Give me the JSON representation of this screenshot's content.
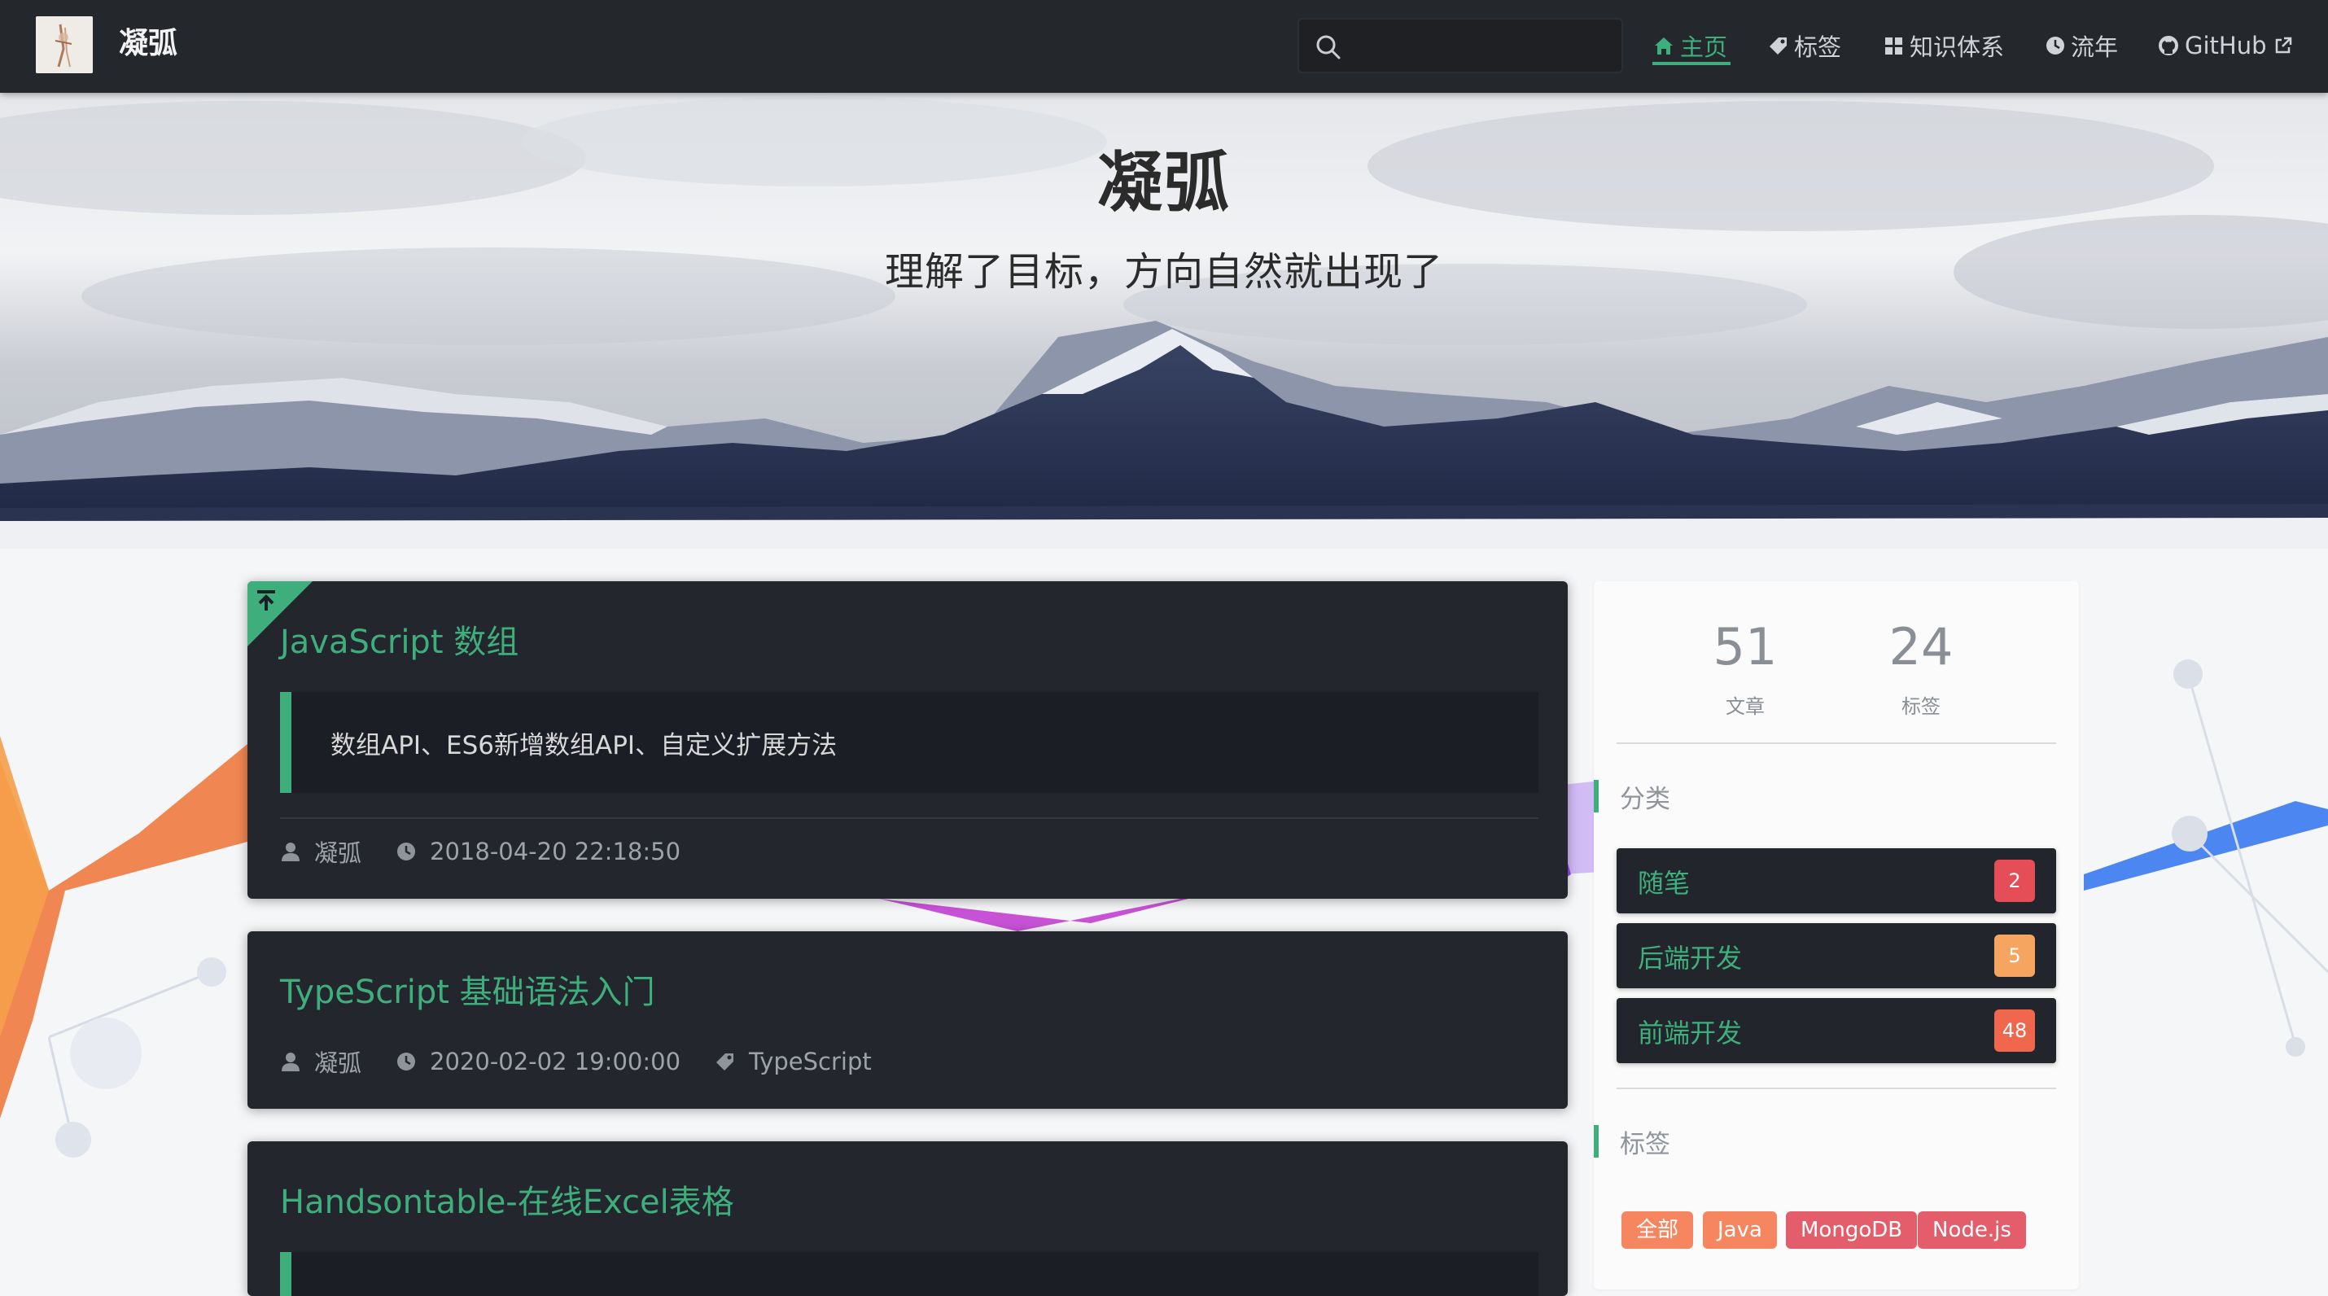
{
  "navbar": {
    "brand_title": "凝弧",
    "search_placeholder": "",
    "links": [
      {
        "label": "主页",
        "icon": "home-icon",
        "active": true
      },
      {
        "label": "标签",
        "icon": "tag-icon",
        "active": false
      },
      {
        "label": "知识体系",
        "icon": "grid-icon",
        "active": false
      },
      {
        "label": "流年",
        "icon": "clock-icon",
        "active": false
      },
      {
        "label": "GitHub",
        "icon": "github-icon",
        "external": true
      }
    ],
    "accent_color": "#3eaf7c"
  },
  "hero": {
    "title": "凝弧",
    "subtitle": "理解了目标，方向自然就出现了"
  },
  "posts": [
    {
      "title": "JavaScript 数组",
      "pinned": true,
      "excerpt": "数组API、ES6新增数组API、自定义扩展方法",
      "author": "凝弧",
      "date": "2018-04-20 22:18:50"
    },
    {
      "title": "TypeScript 基础语法入门",
      "pinned": false,
      "author": "凝弧",
      "date": "2020-02-02 19:00:00",
      "tag": "TypeScript"
    },
    {
      "title": "Handsontable-在线Excel表格",
      "pinned": false
    }
  ],
  "sidebar": {
    "stats": [
      {
        "value": "51",
        "label": "文章"
      },
      {
        "value": "24",
        "label": "标签"
      }
    ],
    "categories_heading": "分类",
    "categories": [
      {
        "name": "随笔",
        "count": "2",
        "color": "#e54d57"
      },
      {
        "name": "后端开发",
        "count": "5",
        "color": "#f5a55f"
      },
      {
        "name": "前端开发",
        "count": "48",
        "color": "#f0674d"
      }
    ],
    "tags_heading": "标签",
    "tags": [
      {
        "label": "全部",
        "color": "#f5865f"
      },
      {
        "label": "Java",
        "color": "#f5865f"
      },
      {
        "label": "MongoDB",
        "color": "#e35d6a"
      },
      {
        "label": "Node.js",
        "color": "#e35d6a"
      }
    ]
  }
}
